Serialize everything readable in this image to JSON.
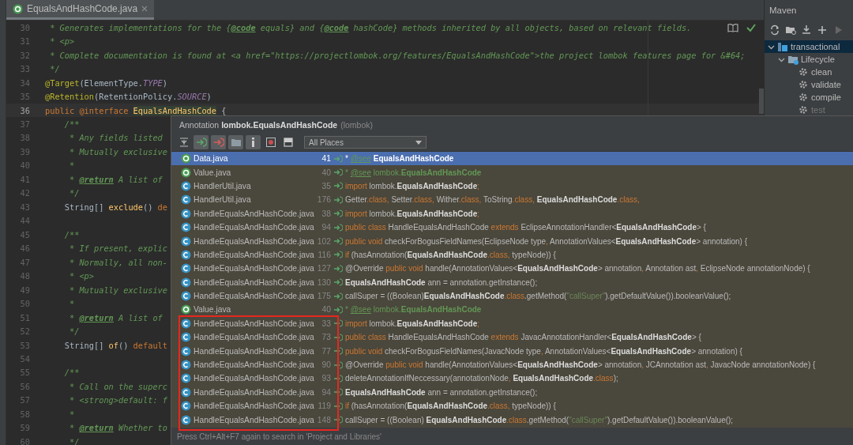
{
  "editor": {
    "tab": {
      "label": "EqualsAndHashCode.java",
      "selected": true
    },
    "lines": [
      {
        "number": "30",
        "current": false,
        "segments": [
          {
            "text": " * Generates implementations for the {",
            "kind": "c"
          },
          {
            "text": "@code",
            "kind": "ct"
          },
          {
            "text": " equals} and {",
            "kind": "c"
          },
          {
            "text": "@code",
            "kind": "ct"
          },
          {
            "text": " hashCode} methods inherited by all objects, based on relevant fields.",
            "kind": "c"
          }
        ]
      },
      {
        "number": "31",
        "current": false,
        "segments": [
          {
            "text": " * ",
            "kind": "c"
          },
          {
            "text": "<p>",
            "kind": "tag"
          }
        ]
      },
      {
        "number": "32",
        "current": false,
        "segments": [
          {
            "text": " * Complete documentation is found at ",
            "kind": "c"
          },
          {
            "text": "<a href=\"https://projectlombok.org/features/EqualsAndHashCode\">",
            "kind": "tag"
          },
          {
            "text": "the project lombok features page for &#64;",
            "kind": "c"
          }
        ]
      },
      {
        "number": "33",
        "current": false,
        "segments": [
          {
            "text": " */",
            "kind": "c"
          }
        ]
      },
      {
        "number": "34",
        "current": false,
        "segments": [
          {
            "text": "@Target",
            "kind": "ann"
          },
          {
            "text": "(ElementType.",
            "kind": "pl"
          },
          {
            "text": "TYPE",
            "kind": "cst"
          },
          {
            "text": ")",
            "kind": "pl"
          }
        ]
      },
      {
        "number": "35",
        "current": false,
        "segments": [
          {
            "text": "@Retention",
            "kind": "ann"
          },
          {
            "text": "(RetentionPolicy.",
            "kind": "pl"
          },
          {
            "text": "SOURCE",
            "kind": "cst"
          },
          {
            "text": ")",
            "kind": "pl"
          }
        ]
      },
      {
        "number": "36",
        "current": true,
        "segments": [
          {
            "text": "public ",
            "kind": "kw"
          },
          {
            "text": "@interface ",
            "kind": "kw"
          },
          {
            "text": "EqualsAndHashCode",
            "kind": "hl"
          },
          {
            "text": " {",
            "kind": "pl"
          }
        ]
      },
      {
        "number": "37",
        "current": false,
        "segments": [
          {
            "text": "    /**",
            "kind": "c"
          }
        ]
      },
      {
        "number": "38",
        "current": false,
        "segments": [
          {
            "text": "     * Any fields listed",
            "kind": "c"
          }
        ]
      },
      {
        "number": "39",
        "current": false,
        "segments": [
          {
            "text": "     * Mutually exclusive",
            "kind": "c"
          }
        ]
      },
      {
        "number": "40",
        "current": false,
        "segments": [
          {
            "text": "     *",
            "kind": "c"
          }
        ]
      },
      {
        "number": "41",
        "current": false,
        "segments": [
          {
            "text": "     * ",
            "kind": "c"
          },
          {
            "text": "@return",
            "kind": "ct"
          },
          {
            "text": " A list of",
            "kind": "c"
          }
        ]
      },
      {
        "number": "42",
        "current": false,
        "segments": [
          {
            "text": "     */",
            "kind": "c"
          }
        ]
      },
      {
        "number": "43",
        "current": false,
        "segments": [
          {
            "text": "    String[] ",
            "kind": "pl"
          },
          {
            "text": "exclude",
            "kind": "fn"
          },
          {
            "text": "() ",
            "kind": "pl"
          },
          {
            "text": "de",
            "kind": "kw"
          }
        ]
      },
      {
        "number": "44",
        "current": false
      },
      {
        "number": "45",
        "current": false,
        "segments": [
          {
            "text": "    /**",
            "kind": "c"
          }
        ]
      },
      {
        "number": "46",
        "current": false,
        "segments": [
          {
            "text": "     * If present, explic",
            "kind": "c"
          }
        ]
      },
      {
        "number": "47",
        "current": false,
        "segments": [
          {
            "text": "     * Normally, all non-",
            "kind": "c"
          }
        ]
      },
      {
        "number": "48",
        "current": false,
        "segments": [
          {
            "text": "     * ",
            "kind": "c"
          },
          {
            "text": "<p>",
            "kind": "tag"
          }
        ]
      },
      {
        "number": "49",
        "current": false,
        "segments": [
          {
            "text": "     * Mutually exclusive",
            "kind": "c"
          }
        ]
      },
      {
        "number": "50",
        "current": false,
        "segments": [
          {
            "text": "     *",
            "kind": "c"
          }
        ]
      },
      {
        "number": "51",
        "current": false,
        "segments": [
          {
            "text": "     * ",
            "kind": "c"
          },
          {
            "text": "@return",
            "kind": "ct"
          },
          {
            "text": " A list of",
            "kind": "c"
          }
        ]
      },
      {
        "number": "52",
        "current": false,
        "segments": [
          {
            "text": "     */",
            "kind": "c"
          }
        ]
      },
      {
        "number": "53",
        "current": false,
        "segments": [
          {
            "text": "    String[] ",
            "kind": "pl"
          },
          {
            "text": "of",
            "kind": "fn"
          },
          {
            "text": "() ",
            "kind": "pl"
          },
          {
            "text": "default",
            "kind": "kw"
          }
        ]
      },
      {
        "number": "54",
        "current": false
      },
      {
        "number": "55",
        "current": false,
        "segments": [
          {
            "text": "    /**",
            "kind": "c"
          }
        ]
      },
      {
        "number": "56",
        "current": false,
        "segments": [
          {
            "text": "     * Call on the superc",
            "kind": "c"
          }
        ]
      },
      {
        "number": "57",
        "current": false,
        "segments": [
          {
            "text": "     * ",
            "kind": "c"
          },
          {
            "text": "<strong>",
            "kind": "tag"
          },
          {
            "text": "default: f",
            "kind": "c"
          }
        ]
      },
      {
        "number": "58",
        "current": false,
        "segments": [
          {
            "text": "     *",
            "kind": "c"
          }
        ]
      },
      {
        "number": "59",
        "current": false,
        "segments": [
          {
            "text": "     * ",
            "kind": "c"
          },
          {
            "text": "@return",
            "kind": "ct"
          },
          {
            "text": " Whether to",
            "kind": "c"
          }
        ]
      },
      {
        "number": "60",
        "current": false,
        "segments": [
          {
            "text": "     */",
            "kind": "c"
          }
        ]
      }
    ]
  },
  "maven": {
    "title": "Maven",
    "tree": [
      {
        "label": "transactional",
        "kind": "project",
        "expanded": true,
        "selected": true,
        "dimmed": false,
        "children": [
          {
            "label": "Lifecycle",
            "kind": "folder",
            "expanded": true,
            "selected": false,
            "dimmed": false,
            "children": [
              {
                "label": "clean",
                "kind": "goal",
                "selected": false,
                "dimmed": false
              },
              {
                "label": "validate",
                "kind": "goal",
                "selected": false,
                "dimmed": false
              },
              {
                "label": "compile",
                "kind": "goal",
                "selected": false,
                "dimmed": false
              },
              {
                "label": "test",
                "kind": "goal",
                "selected": false,
                "dimmed": true
              }
            ]
          }
        ]
      }
    ]
  },
  "popup": {
    "title": "Annotation **lombok.EqualsAndHashCode**",
    "package": "(lombok)",
    "tools": [
      {
        "kind": "expand",
        "pressed": false
      },
      {
        "kind": "read",
        "pressed": true
      },
      {
        "kind": "write",
        "pressed": true
      },
      {
        "kind": "folder",
        "pressed": true
      },
      {
        "kind": "info",
        "pressed": true
      },
      {
        "kind": "module",
        "pressed": false
      },
      {
        "kind": "preview",
        "pressed": false
      }
    ],
    "scope": "All Places",
    "usages": [
      {
        "kind": "annotation",
        "file": "Data.java",
        "line": "41",
        "selected": true,
        "code": [
          {
            "text": "* ",
            "kind": "pl"
          },
          {
            "text": "@see",
            "kind": "tag"
          },
          {
            "text": " EqualsAndHashCode",
            "kind": "b"
          }
        ]
      },
      {
        "kind": "annotation",
        "file": "Value.java",
        "line": "40",
        "selected": false,
        "code": [
          {
            "text": "* ",
            "kind": "g"
          },
          {
            "text": "@see",
            "kind": "tag"
          },
          {
            "text": " lombok.",
            "kind": "g"
          },
          {
            "text": "EqualsAndHashCode",
            "kind": "gb"
          }
        ]
      },
      {
        "kind": "class",
        "file": "HandlerUtil.java",
        "line": "35",
        "selected": false,
        "code": [
          {
            "text": "import",
            "kind": "kw"
          },
          {
            "text": " lombok.",
            "kind": "pl"
          },
          {
            "text": "EqualsAndHashCode",
            "kind": "b"
          },
          {
            "text": ";",
            "kind": "kw"
          }
        ]
      },
      {
        "kind": "class",
        "file": "HandlerUtil.java",
        "line": "176",
        "selected": false,
        "code": [
          {
            "text": "Getter",
            "kind": "pl"
          },
          {
            "text": ".class, ",
            "kind": "kw"
          },
          {
            "text": "Setter",
            "kind": "pl"
          },
          {
            "text": ".class, ",
            "kind": "kw"
          },
          {
            "text": "Wither",
            "kind": "pl"
          },
          {
            "text": ".class, ",
            "kind": "kw"
          },
          {
            "text": "ToString",
            "kind": "pl"
          },
          {
            "text": ".class, ",
            "kind": "kw"
          },
          {
            "text": "EqualsAndHashCode",
            "kind": "b"
          },
          {
            "text": ".class,",
            "kind": "kw"
          }
        ]
      },
      {
        "kind": "class",
        "file": "HandleEqualsAndHashCode.java",
        "line": "38",
        "selected": false,
        "code": [
          {
            "text": "import",
            "kind": "kw"
          },
          {
            "text": " lombok.",
            "kind": "pl"
          },
          {
            "text": "EqualsAndHashCode",
            "kind": "b"
          },
          {
            "text": ";",
            "kind": "kw"
          }
        ]
      },
      {
        "kind": "class",
        "file": "HandleEqualsAndHashCode.java",
        "line": "94",
        "selected": false,
        "code": [
          {
            "text": "public class",
            "kind": "kw"
          },
          {
            "text": " HandleEqualsAndHashCode ",
            "kind": "pl"
          },
          {
            "text": "extends",
            "kind": "kw"
          },
          {
            "text": " EclipseAnnotationHandler<",
            "kind": "pl"
          },
          {
            "text": "EqualsAndHashCode",
            "kind": "b"
          },
          {
            "text": "> {",
            "kind": "pl"
          }
        ]
      },
      {
        "kind": "class",
        "file": "HandleEqualsAndHashCode.java",
        "line": "102",
        "selected": false,
        "code": [
          {
            "text": "public void",
            "kind": "kw"
          },
          {
            "text": " checkForBogusFieldNames(EclipseNode type",
            "kind": "pl"
          },
          {
            "text": ", ",
            "kind": "kw"
          },
          {
            "text": "AnnotationValues<",
            "kind": "pl"
          },
          {
            "text": "EqualsAndHashCode",
            "kind": "b"
          },
          {
            "text": "> annotation) {",
            "kind": "pl"
          }
        ]
      },
      {
        "kind": "class",
        "file": "HandleEqualsAndHashCode.java",
        "line": "116",
        "selected": false,
        "code": [
          {
            "text": "if",
            "kind": "kw"
          },
          {
            "text": " (hasAnnotation(",
            "kind": "pl"
          },
          {
            "text": "EqualsAndHashCode",
            "kind": "b"
          },
          {
            "text": ".class, ",
            "kind": "kw"
          },
          {
            "text": "typeNode)) {",
            "kind": "pl"
          }
        ]
      },
      {
        "kind": "class",
        "file": "HandleEqualsAndHashCode.java",
        "line": "127",
        "selected": false,
        "code": [
          {
            "text": "@Override ",
            "kind": "pl"
          },
          {
            "text": "public void",
            "kind": "kw"
          },
          {
            "text": " handle(AnnotationValues<",
            "kind": "pl"
          },
          {
            "text": "EqualsAndHashCode",
            "kind": "b"
          },
          {
            "text": "> annotation",
            "kind": "pl"
          },
          {
            "text": ", ",
            "kind": "kw"
          },
          {
            "text": "Annotation ast",
            "kind": "pl"
          },
          {
            "text": ", ",
            "kind": "kw"
          },
          {
            "text": "EclipseNode annotationNode) {",
            "kind": "pl"
          }
        ]
      },
      {
        "kind": "class",
        "file": "HandleEqualsAndHashCode.java",
        "line": "130",
        "selected": false,
        "code": [
          {
            "text": "EqualsAndHashCode",
            "kind": "b"
          },
          {
            "text": " ann = annotation.getInstance();",
            "kind": "pl"
          }
        ]
      },
      {
        "kind": "class",
        "file": "HandleEqualsAndHashCode.java",
        "line": "175",
        "selected": false,
        "code": [
          {
            "text": "callSuper = ((Boolean)",
            "kind": "pl"
          },
          {
            "text": "EqualsAndHashCode",
            "kind": "b"
          },
          {
            "text": ".class",
            "kind": "kw"
          },
          {
            "text": ".getMethod(",
            "kind": "pl"
          },
          {
            "text": "\"callSuper\"",
            "kind": "s"
          },
          {
            "text": ").getDefaultValue()).booleanValue();",
            "kind": "pl"
          }
        ]
      },
      {
        "kind": "annotation",
        "file": "Value.java",
        "line": "40",
        "selected": false,
        "code": [
          {
            "text": "* ",
            "kind": "g"
          },
          {
            "text": "@see",
            "kind": "tag"
          },
          {
            "text": " lombok.",
            "kind": "g"
          },
          {
            "text": "EqualsAndHashCode",
            "kind": "gb"
          }
        ]
      }
    ],
    "outlined_usages": [
      {
        "kind": "class",
        "file": "HandleEqualsAndHashCode.java",
        "line": "33",
        "selected": false,
        "code": [
          {
            "text": "import",
            "kind": "kw"
          },
          {
            "text": " lombok.",
            "kind": "pl"
          },
          {
            "text": "EqualsAndHashCode",
            "kind": "b"
          },
          {
            "text": ";",
            "kind": "kw"
          }
        ]
      },
      {
        "kind": "class",
        "file": "HandleEqualsAndHashCode.java",
        "line": "73",
        "selected": false,
        "code": [
          {
            "text": "public class",
            "kind": "kw"
          },
          {
            "text": " HandleEqualsAndHashCode ",
            "kind": "pl"
          },
          {
            "text": "extends",
            "kind": "kw"
          },
          {
            "text": " JavacAnnotationHandler<",
            "kind": "pl"
          },
          {
            "text": "EqualsAndHashCode",
            "kind": "b"
          },
          {
            "text": "> {",
            "kind": "pl"
          }
        ]
      },
      {
        "kind": "class",
        "file": "HandleEqualsAndHashCode.java",
        "line": "77",
        "selected": false,
        "code": [
          {
            "text": "public void",
            "kind": "kw"
          },
          {
            "text": " checkForBogusFieldNames(JavacNode type",
            "kind": "pl"
          },
          {
            "text": ", ",
            "kind": "kw"
          },
          {
            "text": "AnnotationValues<",
            "kind": "pl"
          },
          {
            "text": "EqualsAndHashCode",
            "kind": "b"
          },
          {
            "text": "> annotation) {",
            "kind": "pl"
          }
        ]
      },
      {
        "kind": "class",
        "file": "HandleEqualsAndHashCode.java",
        "line": "90",
        "selected": false,
        "code": [
          {
            "text": "@Override ",
            "kind": "pl"
          },
          {
            "text": "public void",
            "kind": "kw"
          },
          {
            "text": " handle(AnnotationValues<",
            "kind": "pl"
          },
          {
            "text": "EqualsAndHashCode",
            "kind": "b"
          },
          {
            "text": "> annotation",
            "kind": "pl"
          },
          {
            "text": ", ",
            "kind": "kw"
          },
          {
            "text": "JCAnnotation ast",
            "kind": "pl"
          },
          {
            "text": ", ",
            "kind": "kw"
          },
          {
            "text": "JavacNode annotationNode) {",
            "kind": "pl"
          }
        ]
      },
      {
        "kind": "class",
        "file": "HandleEqualsAndHashCode.java",
        "line": "93",
        "selected": false,
        "code": [
          {
            "text": "deleteAnnotationIfNeccessary(annotationNode",
            "kind": "pl"
          },
          {
            "text": ", ",
            "kind": "kw"
          },
          {
            "text": "EqualsAndHashCode",
            "kind": "b"
          },
          {
            "text": ".class",
            "kind": "kw"
          },
          {
            "text": ");",
            "kind": "pl"
          }
        ]
      },
      {
        "kind": "class",
        "file": "HandleEqualsAndHashCode.java",
        "line": "94",
        "selected": false,
        "code": [
          {
            "text": "EqualsAndHashCode",
            "kind": "b"
          },
          {
            "text": " ann = annotation.getInstance();",
            "kind": "pl"
          }
        ]
      },
      {
        "kind": "class",
        "file": "HandleEqualsAndHashCode.java",
        "line": "119",
        "selected": false,
        "code": [
          {
            "text": "if",
            "kind": "kw"
          },
          {
            "text": " (hasAnnotation(",
            "kind": "pl"
          },
          {
            "text": "EqualsAndHashCode",
            "kind": "b"
          },
          {
            "text": ".class, ",
            "kind": "kw"
          },
          {
            "text": "typeNode)) {",
            "kind": "pl"
          }
        ]
      },
      {
        "kind": "class",
        "file": "HandleEqualsAndHashCode.java",
        "line": "148",
        "selected": false,
        "code": [
          {
            "text": "callSuper = ((Boolean) ",
            "kind": "pl"
          },
          {
            "text": "EqualsAndHashCode",
            "kind": "b"
          },
          {
            "text": ".class",
            "kind": "kw"
          },
          {
            "text": ".getMethod(",
            "kind": "pl"
          },
          {
            "text": "\"callSuper\"",
            "kind": "s"
          },
          {
            "text": ").getDefaultValue()).booleanValue();",
            "kind": "pl"
          }
        ]
      }
    ],
    "footer": "Press Ctrl+Alt+F7 again to search in 'Project and Libraries'"
  }
}
